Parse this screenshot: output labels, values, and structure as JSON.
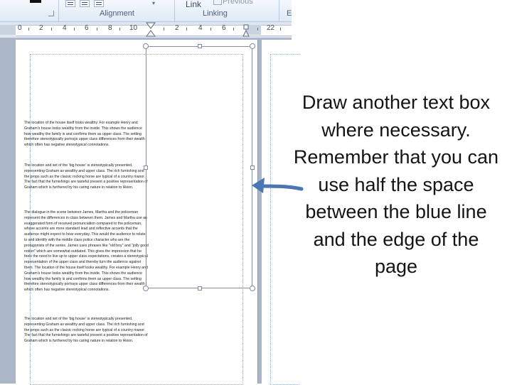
{
  "ribbon": {
    "alignment_label": "Alignment",
    "linking_label": "Linking",
    "link_label": "Link",
    "previous_label": "Previous",
    "edge_letter": "E"
  },
  "ruler": {
    "numbers": [
      "0",
      "2",
      "4",
      "6",
      "8",
      "10",
      "2",
      "4",
      "6",
      "22"
    ]
  },
  "document": {
    "paragraphs": [
      "The location of the house itself looks wealthy. For example Henry and Graham's house looks wealthy from the inside. This shows the audience how wealthy the family is and confirms them as upper class. The setting therefore stereotypically portrays upper class differences from their wealth which often has negative stereotypical connotations.",
      "The location and set of the 'big house' is stereotypically presented, representing Graham as wealthy and upper class. The rich furnishing and the props such as the classic rocking horse are typical of a country manor. The fact that the furnishings are tasteful present a positive representation of Graham which is furthered by his caring nature in relation to Hixon.",
      "The dialogue in the scene between James, Martha and the policeman represent the differences in class between them. James and Martha use an exaggerated form of received pronunciation compared to the policeman, whose accents are more standard lead and reflective accents that the audience might expect to hear everyday. This would the audience to relate to and identify with the middle class police character who are the protagonists of the series. James uses phrases like \"old boy\" and \"jolly good notion\" which are somewhat outdated. This gives the impression that he feels the need to live up to upper class expectations, creates a stereotypical representation of the upper class and thereby turn the audience against them. The location of the house itself looks wealthy. For example Henry and Graham's house looks wealthy from the inside. This shows the audience how wealthy the family is and confirms them as upper class. The setting therefore stereotypically portrays upper class differences from their wealth which often has negative stereotypical connotations.",
      "The location and set of the 'big house' is stereotypically presented, representing Graham as wealthy and upper class. The rich furnishing and the props such as the classic rocking horse are typical of a country manor. The fact that the furnishings are tasteful present a positive representation of Graham which is furthered by his caring nature in relation to Hixon."
    ]
  },
  "instruction": {
    "text": "Draw another text box where necessary. Remember that you can use half the space between the blue line and the edge of the page"
  },
  "colors": {
    "arrow": "#4a76b4",
    "margin_guide": "#8fb4d8",
    "ribbon_bg": "#dfe9f5"
  },
  "icons": [
    "align-left-icon",
    "align-center-icon",
    "align-right-icon",
    "dialog-launcher-icon",
    "indent-marker-icon",
    "arrow-left-icon"
  ]
}
